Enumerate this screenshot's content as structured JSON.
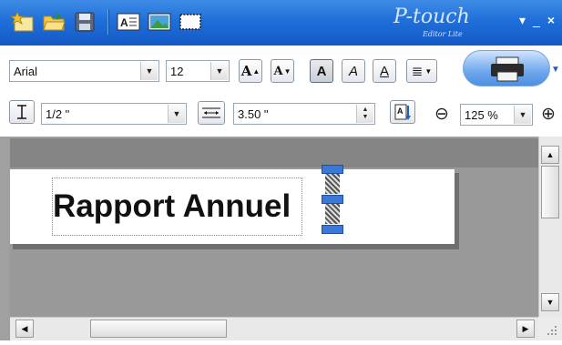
{
  "titlebar": {
    "brand": "P-touch",
    "edition": "Editor Lite",
    "minimize_label": "_",
    "close_label": "×",
    "menu_arrow": "▾",
    "colors": {
      "bar": "#1f6fda",
      "icon_yellow": "#f2c12e"
    }
  },
  "toolbar": {
    "font_name": "Arial",
    "font_size": "12",
    "increase_font_glyph": "A",
    "decrease_font_glyph": "A",
    "bold_glyph": "A",
    "italic_glyph": "A",
    "underline_glyph": "A",
    "align_glyph": "≣",
    "tape_width": "1/2 \"",
    "label_length": "3.50 \"",
    "zoom_value": "125 %",
    "zoom_out_glyph": "⊖",
    "zoom_in_glyph": "⊕"
  },
  "label": {
    "text": "Rapport Annuel"
  },
  "scroll": {
    "up": "▲",
    "down": "▼",
    "left": "◀",
    "right": "▶"
  }
}
